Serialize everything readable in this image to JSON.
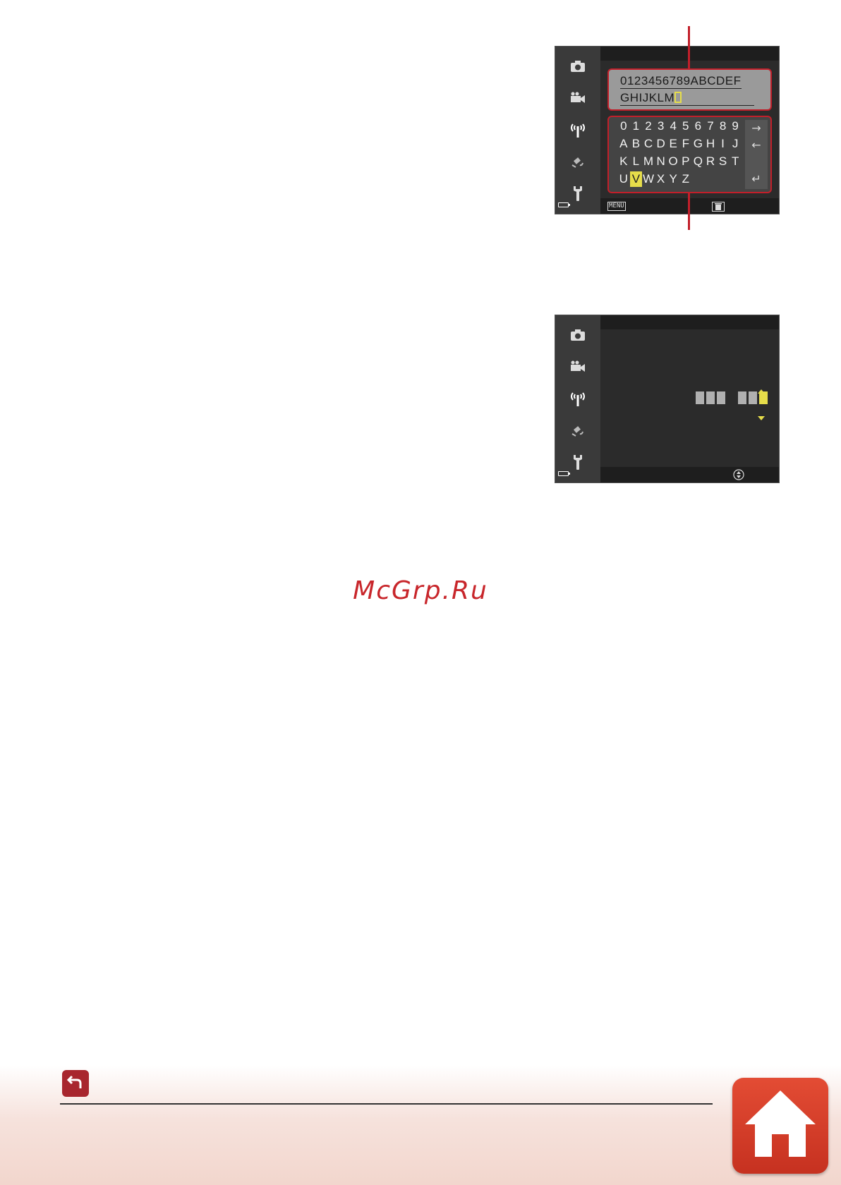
{
  "screen1": {
    "text_entry": {
      "line1": "0123456789ABCDEF",
      "line2": "GHIJKLM"
    },
    "keyboard": {
      "rows": [
        [
          "0",
          "1",
          "2",
          "3",
          "4",
          "5",
          "6",
          "7",
          "8",
          "9"
        ],
        [
          "A",
          "B",
          "C",
          "D",
          "E",
          "F",
          "G",
          "H",
          "I",
          "J"
        ],
        [
          "K",
          "L",
          "M",
          "N",
          "O",
          "P",
          "Q",
          "R",
          "S",
          "T"
        ],
        [
          "U",
          "V",
          "W",
          "X",
          "Y",
          "Z"
        ]
      ],
      "selected_key": "V",
      "side_keys": [
        "→",
        "←",
        "↵"
      ]
    },
    "bottom_menu_label": "MENU"
  },
  "screen2": {
    "digits": {
      "left_count": 3,
      "right_count": 3,
      "selected": "last"
    }
  },
  "watermark": "McGrp.Ru",
  "icons": [
    "camera-icon",
    "movie-camera-icon",
    "wireless-icon",
    "location-icon",
    "wrench-icon",
    "battery-icon",
    "trash-icon",
    "multi-selector-icon",
    "back-icon",
    "home-icon"
  ]
}
